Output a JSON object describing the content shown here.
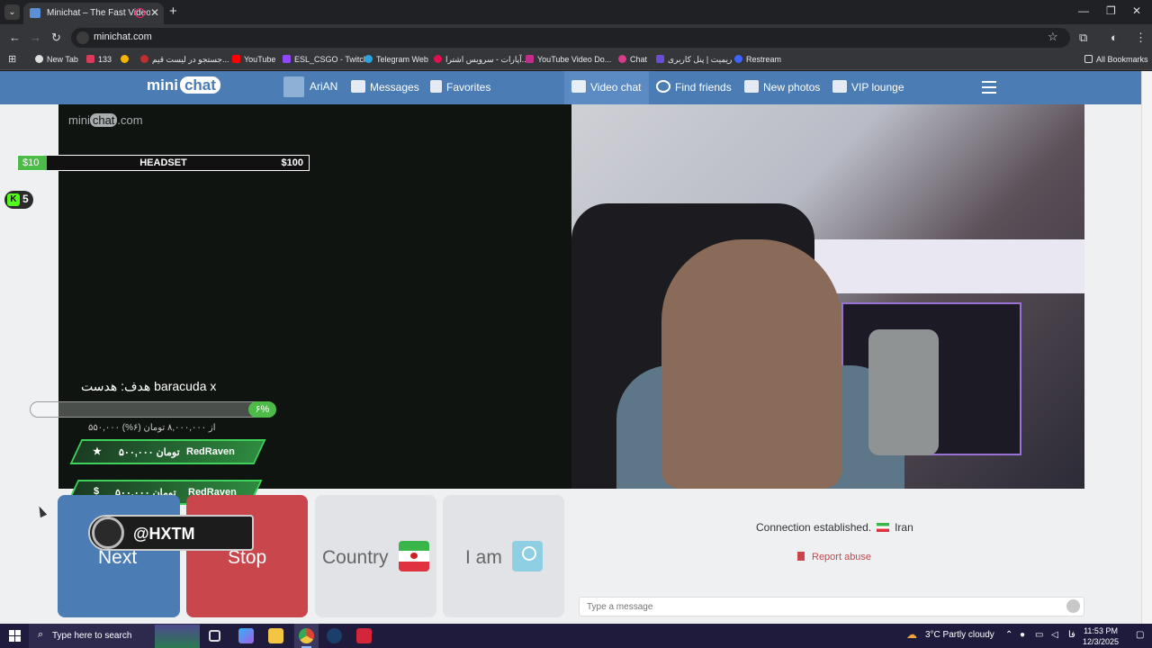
{
  "browser": {
    "tab_title": "Minichat – The Fast Video C",
    "url": "minichat.com",
    "bookmarks": [
      {
        "label": "New Tab",
        "color": "#e8eaed"
      },
      {
        "label": "133",
        "color": "#d93b5a"
      },
      {
        "label": "",
        "color": "#f4b400"
      },
      {
        "label": "جستجو در لیست قیم...",
        "color": "#c02e2e"
      },
      {
        "label": "YouTube",
        "color": "#ff0000"
      },
      {
        "label": "ESL_CSGO - Twitch",
        "color": "#9146ff"
      },
      {
        "label": "Telegram Web",
        "color": "#2aa3df"
      },
      {
        "label": "آپارات - سرویس اشترا...",
        "color": "#df0f50"
      },
      {
        "label": "YouTube Video Do...",
        "color": "#c02e8a"
      },
      {
        "label": "Chat",
        "color": "#d83b8a"
      },
      {
        "label": "ریمیت | پنل کاربری",
        "color": "#6a4cd6"
      },
      {
        "label": "Restream",
        "color": "#3e64ff"
      }
    ],
    "all_bookmarks": "All Bookmarks"
  },
  "site": {
    "logo_mini": "mini",
    "logo_chat": "chat",
    "nav": {
      "user": "AriAN",
      "messages": "Messages",
      "favorites": "Favorites",
      "video_chat": "Video chat",
      "find_friends": "Find friends",
      "new_photos": "New photos",
      "vip_lounge": "VIP lounge"
    },
    "watermark_mini": "mini",
    "watermark_chat": "chat",
    "watermark_com": ".com"
  },
  "overlay": {
    "goal_low": "$10",
    "goal_label": "HEADSET",
    "goal_high": "$100",
    "goal_progress": 0.1,
    "kick_count": "5",
    "donate_title": "هدف: هدست baracuda x",
    "donate_percent": "۶%",
    "donate_sub": "۵۵۰,۰۰۰ از ۸,۰۰۰,۰۰۰ تومان (۶%)",
    "alerts": [
      {
        "name": "RedRaven",
        "amount": "۵۰۰,۰۰۰ تومان"
      },
      {
        "name": "RedRaven",
        "amount": "۵۰۰,۰۰۰ تومان"
      }
    ],
    "hxtm": "@HXTM"
  },
  "controls": {
    "next": "Next",
    "stop": "Stop",
    "country": "Country",
    "iam": "I am"
  },
  "chat": {
    "status": "Connection established.",
    "country": "Iran",
    "report": "Report abuse",
    "placeholder": "Type a message"
  },
  "taskbar": {
    "search_placeholder": "Type here to search",
    "weather": "3°C  Partly cloudy",
    "time": "11:53 PM",
    "date": "12/3/2025",
    "lang": "فا"
  },
  "colors": {
    "brand_blue": "#4b7cb4",
    "stop_red": "#c9474c",
    "goal_green": "#4dbb47"
  }
}
